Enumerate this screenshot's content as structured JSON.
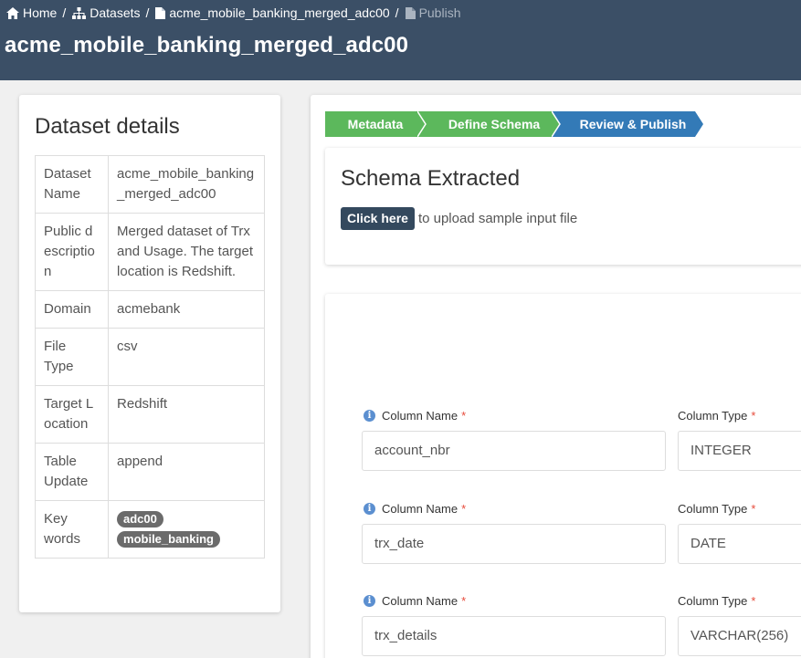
{
  "breadcrumb": {
    "items": [
      {
        "label": "Home",
        "icon": "home-icon"
      },
      {
        "label": "Datasets",
        "icon": "sitemap-icon"
      },
      {
        "label": "acme_mobile_banking_merged_adc00",
        "icon": "file-icon"
      },
      {
        "label": "Publish",
        "icon": "file-icon"
      }
    ],
    "separator": "/"
  },
  "page_title": "acme_mobile_banking_merged_adc00",
  "dataset_details": {
    "title": "Dataset details",
    "rows": [
      {
        "key": "Dataset Name",
        "value": "acme_mobile_banking_merged_adc00"
      },
      {
        "key": "Public description",
        "value": "Merged dataset of Trx and Usage. The target location is Redshift."
      },
      {
        "key": "Domain",
        "value": "acmebank"
      },
      {
        "key": "File Type",
        "value": "csv"
      },
      {
        "key": "Target Location",
        "value": "Redshift"
      },
      {
        "key": "Table Update",
        "value": "append"
      }
    ],
    "keywords_label": "Key words",
    "keywords": [
      "adc00",
      "mobile_banking"
    ]
  },
  "wizard": {
    "steps": [
      {
        "label": "Metadata",
        "state": "done"
      },
      {
        "label": "Define Schema",
        "state": "done"
      },
      {
        "label": "Review & Publish",
        "state": "active"
      }
    ],
    "colors": {
      "done": "#5cb85c",
      "active": "#337ab7"
    }
  },
  "schema": {
    "title": "Schema Extracted",
    "upload_button": "Click here",
    "upload_text": "to upload sample input file"
  },
  "columns": {
    "name_label": "Column Name",
    "type_label": "Column Type",
    "required_mark": "*",
    "rows": [
      {
        "name": "account_nbr",
        "type": "INTEGER"
      },
      {
        "name": "trx_date",
        "type": "DATE"
      },
      {
        "name": "trx_details",
        "type": "VARCHAR(256)"
      }
    ]
  },
  "colors": {
    "header_bg": "#3b4f66",
    "button_dark": "#34495e",
    "required": "#e74c3c",
    "keyword_badge": "#6b6b6b"
  }
}
